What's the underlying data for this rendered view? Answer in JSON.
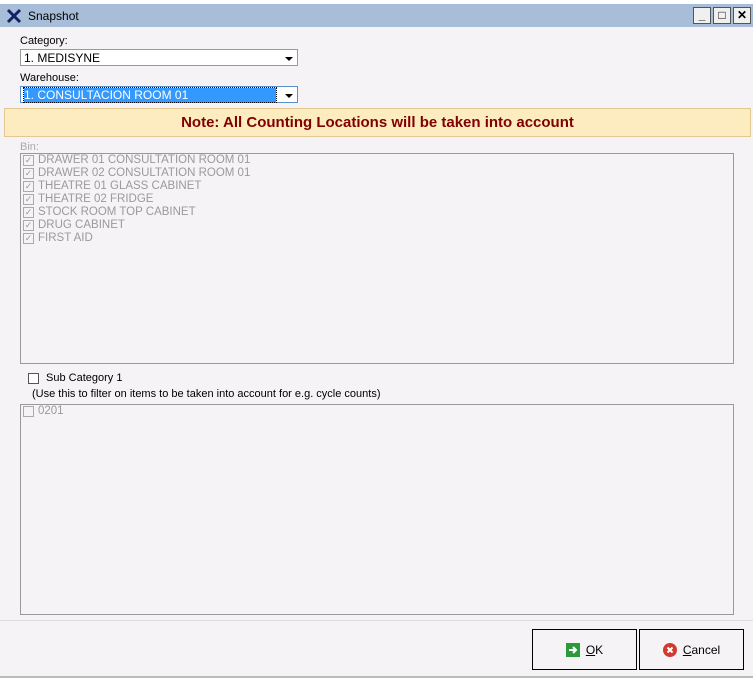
{
  "window": {
    "title": "Snapshot"
  },
  "category": {
    "label": "Category:",
    "value": "1. MEDISYNE"
  },
  "warehouse": {
    "label": "Warehouse:",
    "value": "1. CONSULTACION ROOM 01"
  },
  "note": "Note: All Counting Locations will be taken into account",
  "bin": {
    "label": "Bin:",
    "items": [
      "DRAWER 01 CONSULTATION ROOM 01",
      "DRAWER 02 CONSULTATION ROOM 01",
      "THEATRE 01 GLASS CABINET",
      "THEATRE 02 FRIDGE",
      "STOCK ROOM TOP CABINET",
      "DRUG CABINET",
      "FIRST AID"
    ]
  },
  "sub_category": {
    "label": "Sub Category 1",
    "hint": "(Use this to filter on items to be taken into account for e.g. cycle counts)",
    "items": [
      "0201"
    ]
  },
  "buttons": {
    "ok_mnemonic": "O",
    "ok_rest": "K",
    "cancel_mnemonic": "C",
    "cancel_rest": "ancel"
  }
}
